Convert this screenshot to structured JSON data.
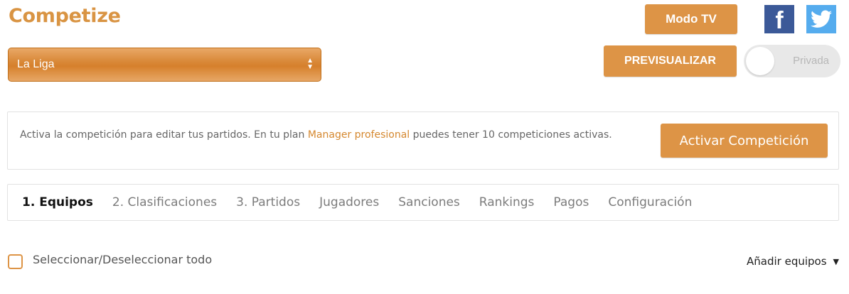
{
  "app": {
    "title": "Competize"
  },
  "header": {
    "modo_tv_label": "Modo TV",
    "facebook_glyph": "f",
    "facebook_icon": "facebook-icon",
    "twitter_icon": "twitter-icon",
    "preview_label": "PREVISUALIZAR",
    "privacy_toggle": {
      "label": "Privada",
      "on": false
    }
  },
  "competition_select": {
    "selected": "La Liga",
    "icon": "select-arrows-icon"
  },
  "notice": {
    "text_before": "Activa la competición para editar tus partidos. En tu plan ",
    "plan_link": "Manager profesional",
    "text_after": " puedes tener 10 competiciones activas.",
    "button_label": "Activar Competición"
  },
  "tabs": [
    {
      "label": "1. Equipos",
      "active": true
    },
    {
      "label": "2. Clasificaciones",
      "active": false
    },
    {
      "label": "3. Partidos",
      "active": false
    },
    {
      "label": "Jugadores",
      "active": false
    },
    {
      "label": "Sanciones",
      "active": false
    },
    {
      "label": "Rankings",
      "active": false
    },
    {
      "label": "Pagos",
      "active": false
    },
    {
      "label": "Configuración",
      "active": false
    }
  ],
  "list_controls": {
    "select_all_label": "Seleccionar/Deseleccionar todo",
    "select_all_checked": false,
    "add_teams_label": "Añadir equipos",
    "add_teams_icon": "caret-down-icon"
  },
  "colors": {
    "brand": "#d99443",
    "button": "#dd9446",
    "facebook": "#3b5998",
    "twitter": "#55acee"
  }
}
